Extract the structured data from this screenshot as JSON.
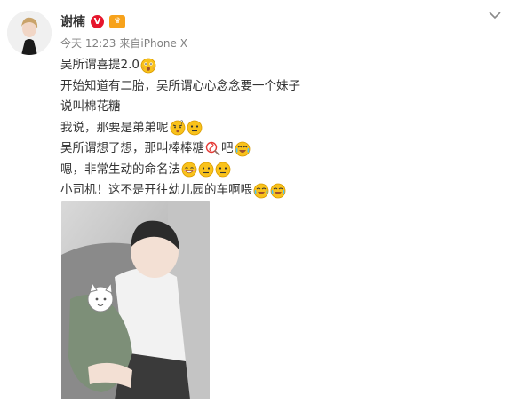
{
  "user": {
    "name": "谢楠",
    "verified_mark": "V",
    "vip_mark": "♛"
  },
  "meta": {
    "date": "今天 12:23",
    "source": "来自iPhone X"
  },
  "lines": [
    {
      "text": "吴所谓喜提2.0",
      "emojis": [
        "shocked-emoji-icon"
      ]
    },
    {
      "text": "开始知道有二胎，吴所谓心心念念要一个妹子",
      "emojis": []
    },
    {
      "text": "说叫棉花糖",
      "emojis": []
    },
    {
      "text": "我说，那要是弟弟呢",
      "emojis": [
        "confused-emoji-icon",
        "speechless-emoji-icon"
      ]
    },
    {
      "text": "吴所谓想了想，那叫棒棒糖",
      "emojis": [
        "lollipop-icon"
      ],
      "text_after": "吧",
      "emojis_after": [
        "laugh-cry-emoji-icon"
      ]
    },
    {
      "text": "嗯，非常生动的命名法",
      "emojis": [
        "grin-emoji-icon",
        "speechless-emoji-icon",
        "speechless-emoji-icon"
      ]
    },
    {
      "text": "小司机！这不是开往幼儿园的车啊喂",
      "emojis": [
        "laugh-cry-emoji-icon",
        "laugh-cry-emoji-icon"
      ]
    }
  ],
  "colors": {
    "text": "#333333",
    "meta": "#808080",
    "verified": "#e6162d",
    "vip": "#f7a21b",
    "emoji": "#f9c21b"
  }
}
